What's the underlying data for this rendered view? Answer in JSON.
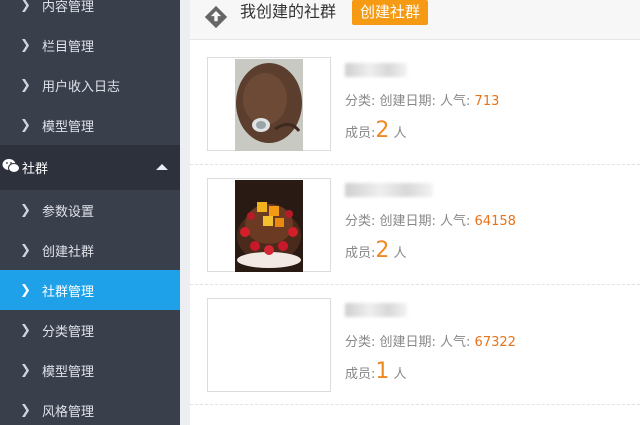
{
  "sidebar": {
    "items_top": [
      {
        "label": "内容管理"
      },
      {
        "label": "栏目管理"
      },
      {
        "label": "用户收入日志"
      },
      {
        "label": "模型管理"
      }
    ],
    "group": {
      "label": "社群",
      "icon": "wechat-icon"
    },
    "items": [
      {
        "label": "参数设置"
      },
      {
        "label": "创建社群"
      },
      {
        "label": "社群管理",
        "active": true
      },
      {
        "label": "分类管理"
      },
      {
        "label": "模型管理"
      },
      {
        "label": "风格管理"
      }
    ]
  },
  "header": {
    "title": "我创建的社群",
    "create_label": "创建社群"
  },
  "cards": [
    {
      "meta_prefix": "分类: 创建日期: 人气: ",
      "popularity": "713",
      "members_label": "成员:",
      "members": "2",
      "members_unit": "人"
    },
    {
      "meta_prefix": "分类: 创建日期: 人气: ",
      "popularity": "64158",
      "members_label": "成员:",
      "members": "2",
      "members_unit": "人"
    },
    {
      "meta_prefix": "分类: 创建日期: 人气: ",
      "popularity": "67322",
      "members_label": "成员:",
      "members": "1",
      "members_unit": "人"
    }
  ],
  "colors": {
    "sidebar_bg": "#3a3f4c",
    "active_bg": "#1ea1e9",
    "accent_orange": "#f59a12",
    "popularity": "#e8731a"
  }
}
